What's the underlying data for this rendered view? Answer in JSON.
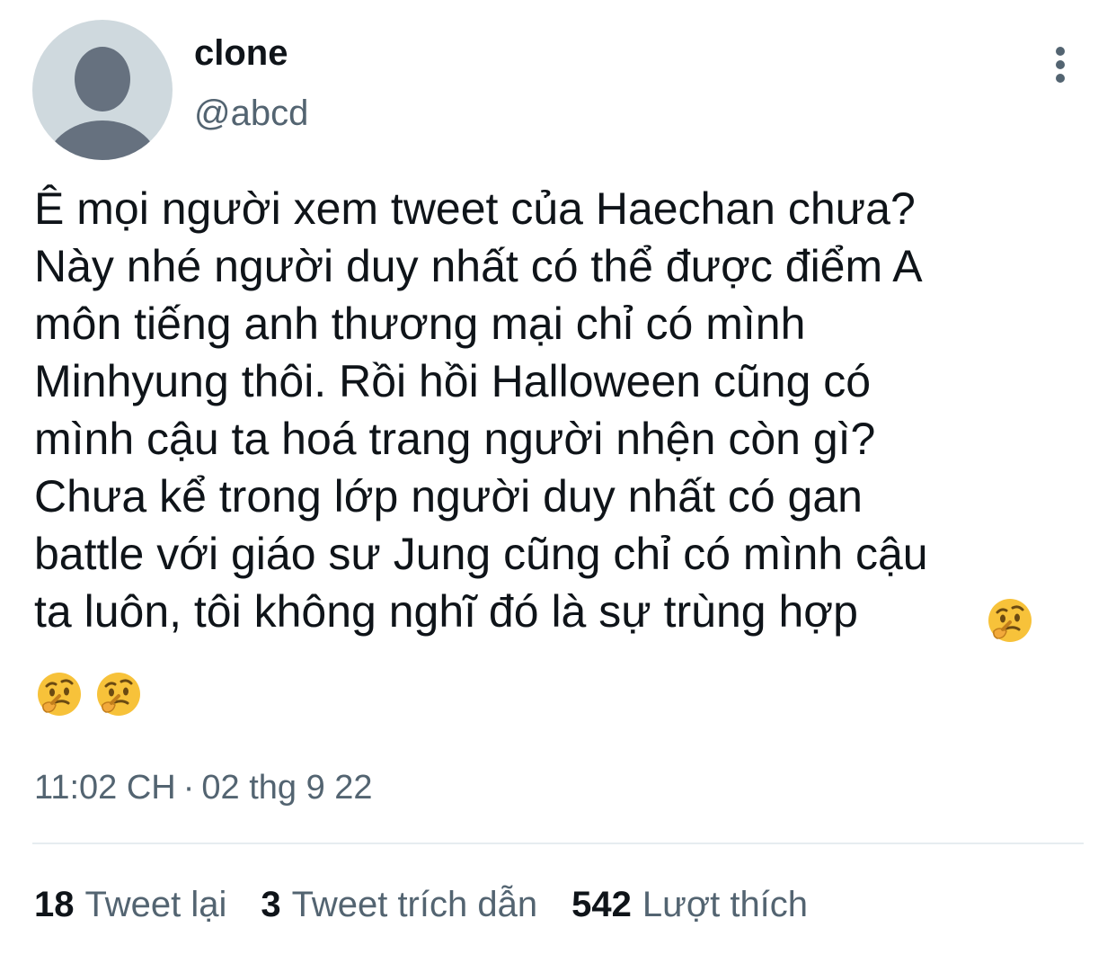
{
  "author": {
    "display_name": "clone",
    "handle": "@abcd"
  },
  "menu": {
    "icon": "more-vertical-icon"
  },
  "tweet": {
    "lines": [
      "Ê mọi người xem tweet của Haechan chưa?",
      "Này nhé người duy nhất có thể được điểm A",
      "môn tiếng anh thương mại chỉ có mình",
      "Minhyung thôi. Rồi hồi Halloween cũng có",
      "mình cậu ta hoá trang người nhện còn gì?",
      "Chưa kể trong lớp người duy nhất có gan",
      "battle với giáo sư Jung cũng chỉ có mình cậu",
      "ta luôn, tôi không nghĩ đó là sự trùng hợp"
    ],
    "emoji": "thinking-face-icon"
  },
  "meta": {
    "time": "11:02 CH",
    "separator": "·",
    "date": "02 thg 9 22"
  },
  "stats": {
    "retweets_count": "18",
    "retweets_label": "Tweet lại",
    "quotes_count": "3",
    "quotes_label": "Tweet trích dẫn",
    "likes_count": "542",
    "likes_label": "Lượt thích"
  },
  "colors": {
    "text_primary": "#0f1419",
    "text_secondary": "#536471",
    "avatar_bg": "#cfd9de",
    "avatar_fg": "#66717f",
    "divider": "#e6ecf0",
    "emoji_yellow": "#f7c23a"
  }
}
